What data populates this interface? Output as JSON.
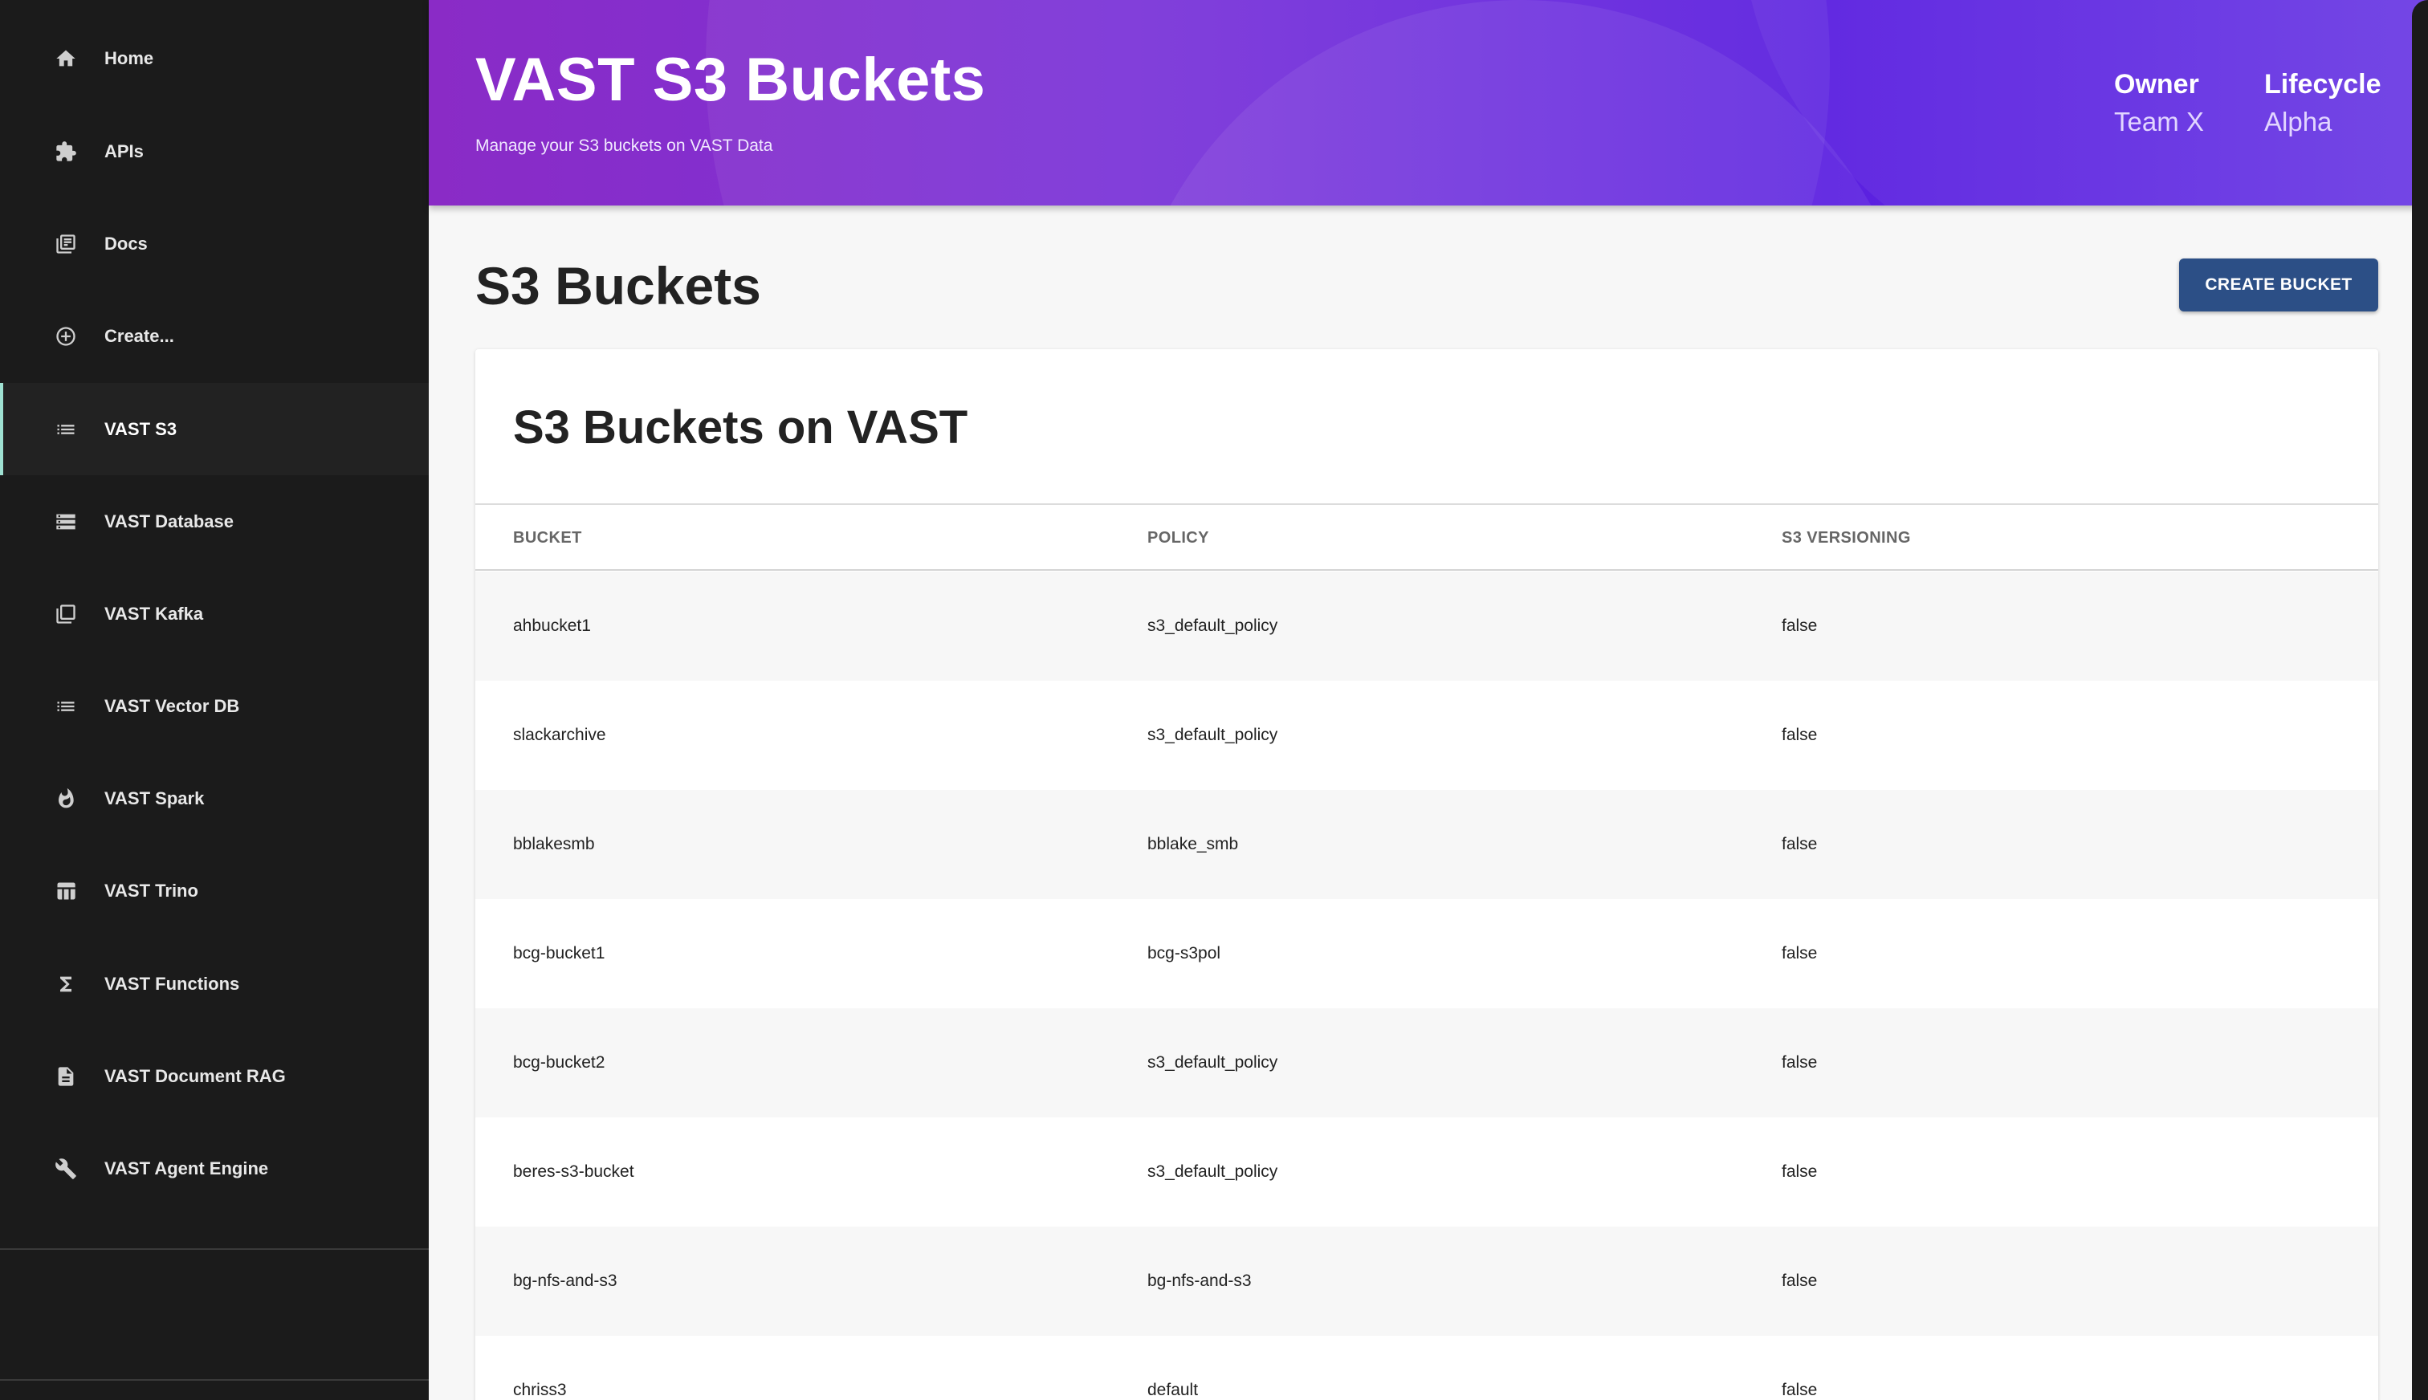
{
  "sidebar": {
    "items": [
      {
        "label": "Home",
        "icon": "home-icon"
      },
      {
        "label": "APIs",
        "icon": "puzzle-icon"
      },
      {
        "label": "Docs",
        "icon": "library-books-icon"
      },
      {
        "label": "Create...",
        "icon": "add-circle-icon"
      },
      {
        "label": "VAST S3",
        "icon": "list-icon",
        "active": true
      },
      {
        "label": "VAST Database",
        "icon": "storage-icon"
      },
      {
        "label": "VAST Kafka",
        "icon": "queue-icon"
      },
      {
        "label": "VAST Vector DB",
        "icon": "list-icon"
      },
      {
        "label": "VAST Spark",
        "icon": "flame-icon"
      },
      {
        "label": "VAST Trino",
        "icon": "table-icon"
      },
      {
        "label": "VAST Functions",
        "icon": "sigma-icon"
      },
      {
        "label": "VAST Document RAG",
        "icon": "document-icon"
      },
      {
        "label": "VAST Agent Engine",
        "icon": "wrench-icon"
      }
    ]
  },
  "header": {
    "title": "VAST S3 Buckets",
    "subtitle": "Manage your S3 buckets on VAST Data",
    "owner_label": "Owner",
    "owner_value": "Team X",
    "lifecycle_label": "Lifecycle",
    "lifecycle_value": "Alpha"
  },
  "main": {
    "page_title": "S3 Buckets",
    "create_button": "CREATE BUCKET",
    "card_title": "S3 Buckets on VAST",
    "columns": [
      "BUCKET",
      "POLICY",
      "S3 VERSIONING"
    ],
    "rows": [
      [
        "ahbucket1",
        "s3_default_policy",
        "false"
      ],
      [
        "slackarchive",
        "s3_default_policy",
        "false"
      ],
      [
        "bblakesmb",
        "bblake_smb",
        "false"
      ],
      [
        "bcg-bucket1",
        "bcg-s3pol",
        "false"
      ],
      [
        "bcg-bucket2",
        "s3_default_policy",
        "false"
      ],
      [
        "beres-s3-bucket",
        "s3_default_policy",
        "false"
      ],
      [
        "bg-nfs-and-s3",
        "bg-nfs-and-s3",
        "false"
      ],
      [
        "chriss3",
        "default",
        "false"
      ]
    ]
  },
  "colors": {
    "sidebar_bg": "#1b1b1b",
    "active_indicator": "#9fe1d2",
    "header_gradient_start": "#8a2bc6",
    "header_gradient_end": "#5a1fe0",
    "button_bg": "#2c4f86"
  }
}
